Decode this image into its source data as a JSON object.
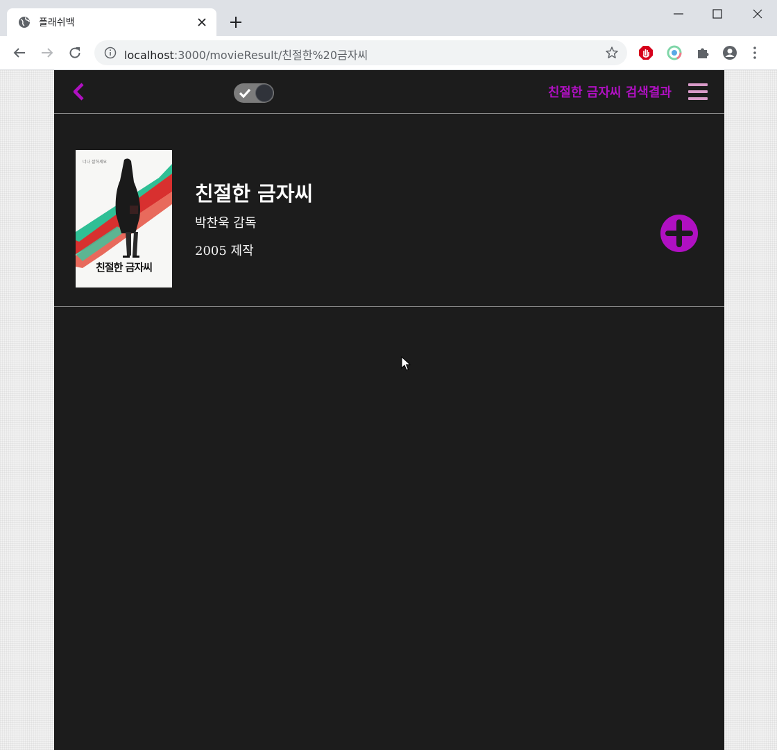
{
  "browser": {
    "tab_title": "플래쉬백",
    "url_host": "localhost",
    "url_path": ":3000/movieResult/친절한%20금자씨"
  },
  "header": {
    "title": "친절한 금자씨 검색결과"
  },
  "results": [
    {
      "title": "친절한 금자씨",
      "director": "박찬욱 감독",
      "year": "2005 제작",
      "poster_title": "친절한 금자씨",
      "poster_tagline": "너나 잘하세요"
    }
  ],
  "colors": {
    "accent": "#b010c2",
    "menu_icon": "#d89ac8",
    "page_bg": "#1c1c1c",
    "divider": "#8a8a8a",
    "toggle_bg": "#7c7c7c"
  },
  "icons": {
    "back": "chevron-left-icon",
    "theme_toggle": "check-icon",
    "menu": "hamburger-menu-icon",
    "add": "plus-circle-icon"
  },
  "theme_toggle_on": true
}
